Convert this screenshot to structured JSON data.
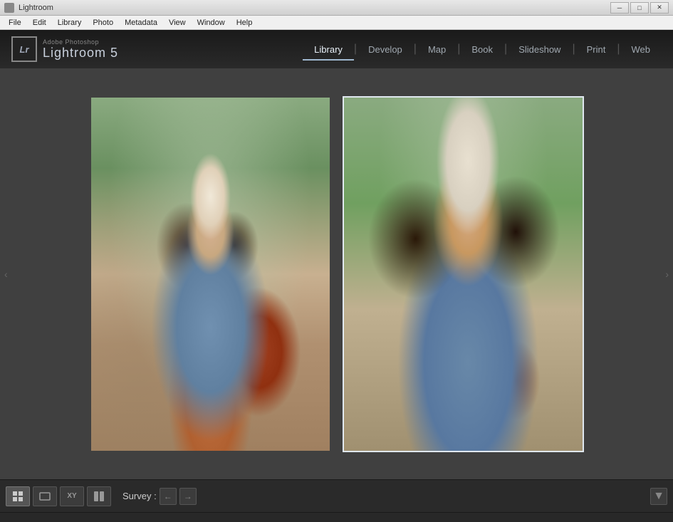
{
  "window": {
    "title": "Lightroom"
  },
  "menubar": {
    "items": [
      "File",
      "Edit",
      "Library",
      "Photo",
      "Metadata",
      "View",
      "Window",
      "Help"
    ]
  },
  "brand": {
    "adobe_label": "Adobe Photoshop",
    "app_name": "Lightroom 5",
    "lr_logo": "Lr"
  },
  "nav": {
    "tabs": [
      {
        "label": "Library",
        "active": true
      },
      {
        "label": "Develop",
        "active": false
      },
      {
        "label": "Map",
        "active": false
      },
      {
        "label": "Book",
        "active": false
      },
      {
        "label": "Slideshow",
        "active": false
      },
      {
        "label": "Print",
        "active": false
      },
      {
        "label": "Web",
        "active": false
      }
    ]
  },
  "view_modes": {
    "grid_label": "⊞",
    "loupe_label": "▭",
    "xy_label": "XY",
    "survey_label": "⊡"
  },
  "bottom": {
    "survey_text": "Survey :",
    "prev_arrow": "←",
    "next_arrow": "→"
  },
  "sidebar": {
    "left_arrow": "‹",
    "right_arrow": "›"
  }
}
